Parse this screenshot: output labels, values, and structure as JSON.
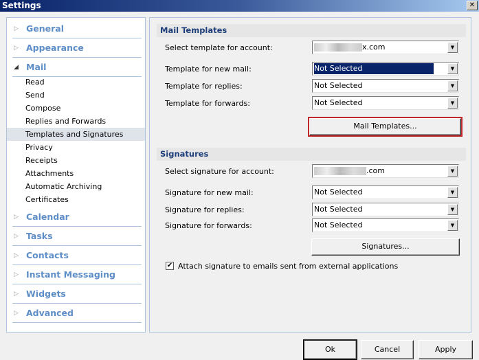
{
  "window": {
    "title": "Settings",
    "close": "✕"
  },
  "sidebar": {
    "general": "General",
    "appearance": "Appearance",
    "mail": "Mail",
    "mail_items": [
      "Read",
      "Send",
      "Compose",
      "Replies and Forwards",
      "Templates and Signatures",
      "Privacy",
      "Receipts",
      "Attachments",
      "Automatic Archiving",
      "Certificates"
    ],
    "selected": "Templates and Signatures",
    "calendar": "Calendar",
    "tasks": "Tasks",
    "contacts": "Contacts",
    "im": "Instant Messaging",
    "widgets": "Widgets",
    "advanced": "Advanced",
    "collapsed_arrow": "▷",
    "expanded_arrow": "◢"
  },
  "templates": {
    "header": "Mail Templates",
    "account_label": "Select template for account:",
    "account_value": "x.com",
    "new_label": "Template for new mail:",
    "new_value": "Not Selected",
    "replies_label": "Template for replies:",
    "replies_value": "Not Selected",
    "forwards_label": "Template for forwards:",
    "forwards_value": "Not Selected",
    "button": "Mail Templates..."
  },
  "signatures": {
    "header": "Signatures",
    "account_label": "Select signature for account:",
    "account_value": ".com",
    "new_label": "Signature for new mail:",
    "new_value": "Not Selected",
    "replies_label": "Signature for replies:",
    "replies_value": "Not Selected",
    "forwards_label": "Signature for forwards:",
    "forwards_value": "Not Selected",
    "button": "Signatures...",
    "attach_label": "Attach signature to emails sent from external applications",
    "attach_checked": true
  },
  "footer": {
    "ok": "Ok",
    "cancel": "Cancel",
    "apply": "Apply"
  },
  "colors": {
    "highlight_border": "#c0282b",
    "selection": "#0a246a",
    "category_text": "#5e8ec7"
  }
}
